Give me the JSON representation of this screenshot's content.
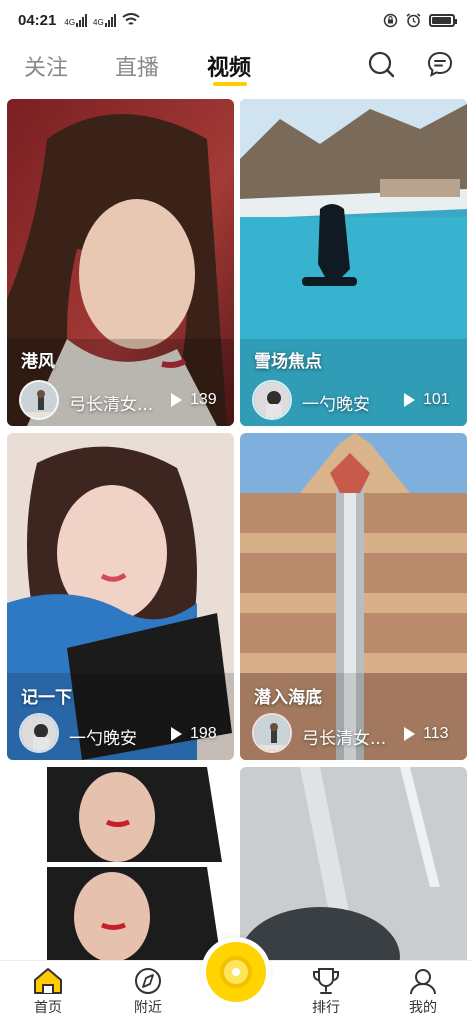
{
  "status_bar": {
    "time": "04:21",
    "net1": "4G",
    "net2": "4G"
  },
  "header": {
    "tabs": [
      {
        "label": "关注"
      },
      {
        "label": "直播"
      },
      {
        "label": "视频"
      }
    ],
    "accent": "#ffcc00"
  },
  "feed": [
    {
      "title": "港风",
      "author": "弓长清女...",
      "views": "139"
    },
    {
      "title": "雪场焦点",
      "author": "一勺晚安",
      "views": "101"
    },
    {
      "title": "记一下",
      "author": "一勺晚安",
      "views": "198"
    },
    {
      "title": "潜入海底",
      "author": "弓长清女...",
      "views": "113"
    }
  ],
  "bottom_nav": {
    "items": [
      {
        "label": "首页"
      },
      {
        "label": "附近"
      },
      {
        "label": "排行"
      },
      {
        "label": "我的"
      }
    ]
  }
}
